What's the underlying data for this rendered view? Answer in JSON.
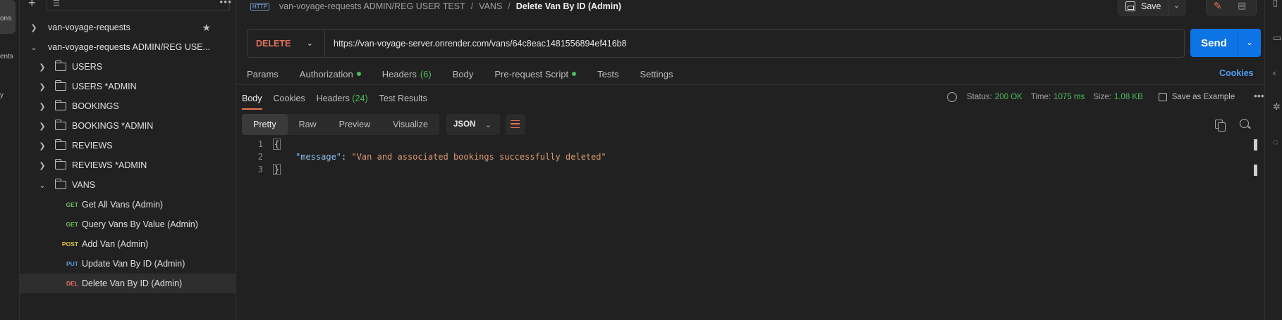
{
  "left_rail": {
    "items": [
      "ons",
      "ents",
      "y"
    ]
  },
  "sidebar": {
    "more_label": "•••",
    "rows": [
      {
        "label": "van-voyage-requests",
        "type": "collection",
        "expanded": false,
        "starred": true
      },
      {
        "label": "van-voyage-requests ADMIN/REG USE...",
        "type": "collection",
        "expanded": true
      },
      {
        "label": "USERS",
        "type": "folder"
      },
      {
        "label": "USERS *ADMIN",
        "type": "folder"
      },
      {
        "label": "BOOKINGS",
        "type": "folder"
      },
      {
        "label": "BOOKINGS *ADMIN",
        "type": "folder"
      },
      {
        "label": "REVIEWS",
        "type": "folder"
      },
      {
        "label": "REVIEWS *ADMIN",
        "type": "folder"
      },
      {
        "label": "VANS",
        "type": "folder",
        "expanded": true
      },
      {
        "label": "Get All Vans (Admin)",
        "type": "request",
        "method": "GET"
      },
      {
        "label": "Query Vans By Value (Admin)",
        "type": "request",
        "method": "GET"
      },
      {
        "label": "Add Van (Admin)",
        "type": "request",
        "method": "POST"
      },
      {
        "label": "Update Van By ID (Admin)",
        "type": "request",
        "method": "PUT"
      },
      {
        "label": "Delete Van By ID (Admin)",
        "type": "request",
        "method": "DEL",
        "selected": true
      }
    ]
  },
  "breadcrumb": {
    "icon": "HTTP",
    "collection": "van-voyage-requests ADMIN/REG USER TEST",
    "folder": "VANS",
    "current": "Delete Van By ID (Admin)"
  },
  "toolbar": {
    "save_label": "Save"
  },
  "request": {
    "method": "DELETE",
    "url": "https://van-voyage-server.onrender.com/vans/64c8eac1481556894ef416b8",
    "send_label": "Send"
  },
  "request_tabs": {
    "params": "Params",
    "authorization": "Authorization",
    "headers": "Headers",
    "headers_count": "(6)",
    "body": "Body",
    "prerequest": "Pre-request Script",
    "tests": "Tests",
    "settings": "Settings",
    "cookies": "Cookies"
  },
  "response_tabs": {
    "body": "Body",
    "cookies": "Cookies",
    "headers": "Headers",
    "headers_count": "(24)",
    "test_results": "Test Results"
  },
  "response_meta": {
    "status_label": "Status:",
    "status_value": "200 OK",
    "time_label": "Time:",
    "time_value": "1075 ms",
    "size_label": "Size:",
    "size_value": "1.08 KB",
    "save_example": "Save as Example",
    "more": "•••"
  },
  "view_tabs": {
    "pretty": "Pretty",
    "raw": "Raw",
    "preview": "Preview",
    "visualize": "Visualize",
    "format": "JSON"
  },
  "response_body": {
    "line_numbers": [
      "1",
      "2",
      "3"
    ],
    "open_brace": "{",
    "key": "\"message\"",
    "colon": ": ",
    "value": "\"Van and associated bookings successfully deleted\"",
    "close_brace": "}"
  },
  "colors": {
    "accent": "#e57254",
    "send": "#0c74e4",
    "success": "#4cbb5c",
    "link": "#4c9ef5"
  }
}
